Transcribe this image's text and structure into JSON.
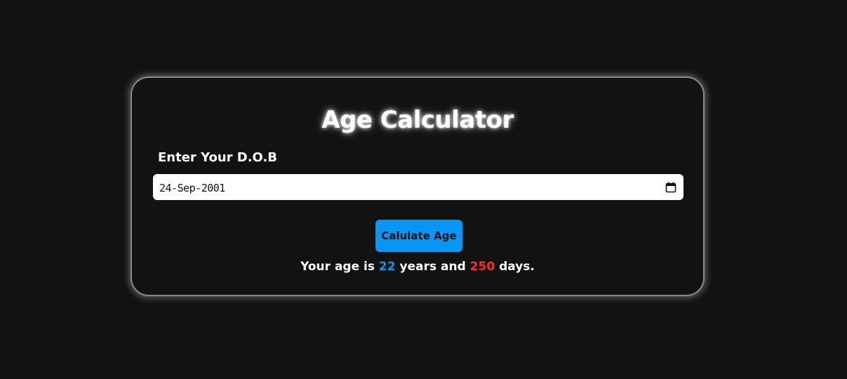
{
  "app": {
    "title": "Age Calculator"
  },
  "form": {
    "dob_label": "Enter Your D.O.B",
    "dob_value": "24-Sep-2001",
    "calculate_button_label": "Calulate Age"
  },
  "result": {
    "prefix": "Your age is",
    "years": "22",
    "years_word": "years and",
    "days": "250",
    "days_word": "days."
  },
  "colors": {
    "background": "#121212",
    "button": "#0a96f5",
    "years_highlight": "#0a96f5",
    "days_highlight": "#ff2a2a"
  },
  "icons": {
    "date_picker": "calendar-icon"
  }
}
